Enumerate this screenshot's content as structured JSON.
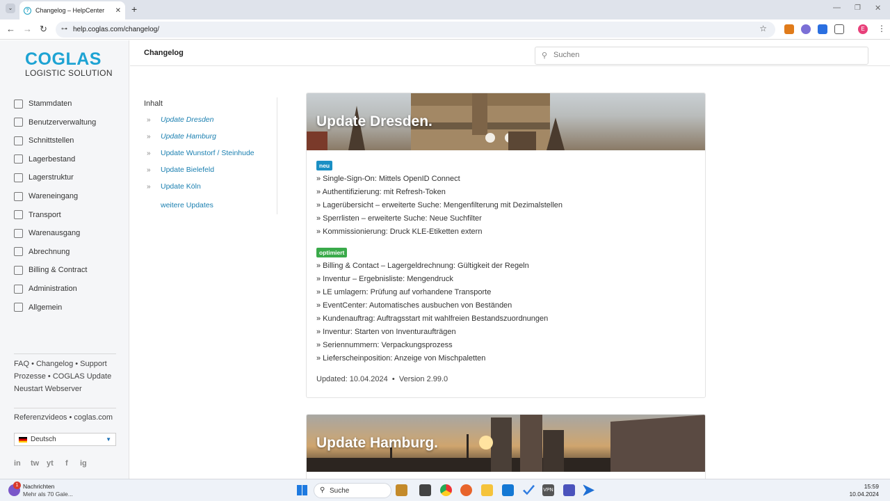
{
  "browser": {
    "tab_title": "Changelog – HelpCenter",
    "url": "help.coglas.com/changelog/"
  },
  "logo": {
    "line1": "COGLAS",
    "line2": "LOGISTIC SOLUTION"
  },
  "sidebar": {
    "items": [
      {
        "label": "Stammdaten",
        "icon": "document-icon"
      },
      {
        "label": "Benutzerverwaltung",
        "icon": "users-icon"
      },
      {
        "label": "Schnittstellen",
        "icon": "plug-icon"
      },
      {
        "label": "Lagerbestand",
        "icon": "shelves-icon"
      },
      {
        "label": "Lagerstruktur",
        "icon": "warehouse-icon"
      },
      {
        "label": "Wareneingang",
        "icon": "truck-in-icon"
      },
      {
        "label": "Transport",
        "icon": "forklift-icon"
      },
      {
        "label": "Warenausgang",
        "icon": "truck-out-icon"
      },
      {
        "label": "Abrechnung",
        "icon": "invoice-icon"
      },
      {
        "label": "Billing & Contract",
        "icon": "contract-icon"
      },
      {
        "label": "Administration",
        "icon": "admin-icon"
      },
      {
        "label": "Allgemein",
        "icon": "bookmark-icon"
      }
    ],
    "footer_links": [
      "FAQ",
      "Changelog",
      "Support",
      "Prozesse",
      "COGLAS Update",
      "Neustart Webserver"
    ],
    "extra_links": [
      "Referenzvideos",
      "coglas.com"
    ],
    "language": "Deutsch",
    "social": [
      "in",
      "tw",
      "yt",
      "f",
      "ig"
    ]
  },
  "header": {
    "title": "Changelog",
    "search_placeholder": "Suchen"
  },
  "toc": {
    "heading": "Inhalt",
    "items": [
      "Update Dresden",
      "Update Hamburg",
      "Update Wunstorf / Steinhude",
      "Update Bielefeld",
      "Update Köln"
    ],
    "more": "weitere Updates"
  },
  "updates": [
    {
      "title": "Update Dresden.",
      "badge_new": "neu",
      "new_items": [
        "» Single-Sign-On: Mittels OpenID Connect",
        "» Authentifizierung: mit Refresh-Token",
        "» Lagerübersicht – erweiterte Suche: Mengenfilterung mit Dezimalstellen",
        "» Sperrlisten – erweiterte Suche: Neue Suchfilter",
        "» Kommissionierung: Druck KLE-Etiketten extern"
      ],
      "badge_opt": "optimiert",
      "opt_items": [
        "» Billing & Contact – Lagergeldrechnung: Gültigkeit der Regeln",
        "» Inventur – Ergebnisliste: Mengendruck",
        "» LE umlagern: Prüfung auf vorhandene Transporte",
        "» EventCenter: Automatisches ausbuchen von Beständen",
        "» Kundenauftrag: Auftragsstart mit wahlfreien Bestandszuordnungen",
        "» Inventur: Starten von Inventuraufträgen",
        "» Seriennummern: Verpackungsprozess",
        "» Lieferscheinposition: Anzeige von Mischpaletten"
      ],
      "updated": "Updated: 10.04.2024",
      "version": "Version 2.99.0"
    },
    {
      "title": "Update Hamburg."
    }
  ],
  "taskbar": {
    "notif_title": "Nachrichten",
    "notif_sub": "Mehr als 70 Gale...",
    "notif_count": "1",
    "search": "Suche",
    "time": "15:59",
    "date": "10.04.2024"
  },
  "colors": {
    "accent": "#1ea3d3",
    "badge_new": "#1a8fc4",
    "badge_opt": "#3aaa4a",
    "link": "#1a7fb0"
  }
}
